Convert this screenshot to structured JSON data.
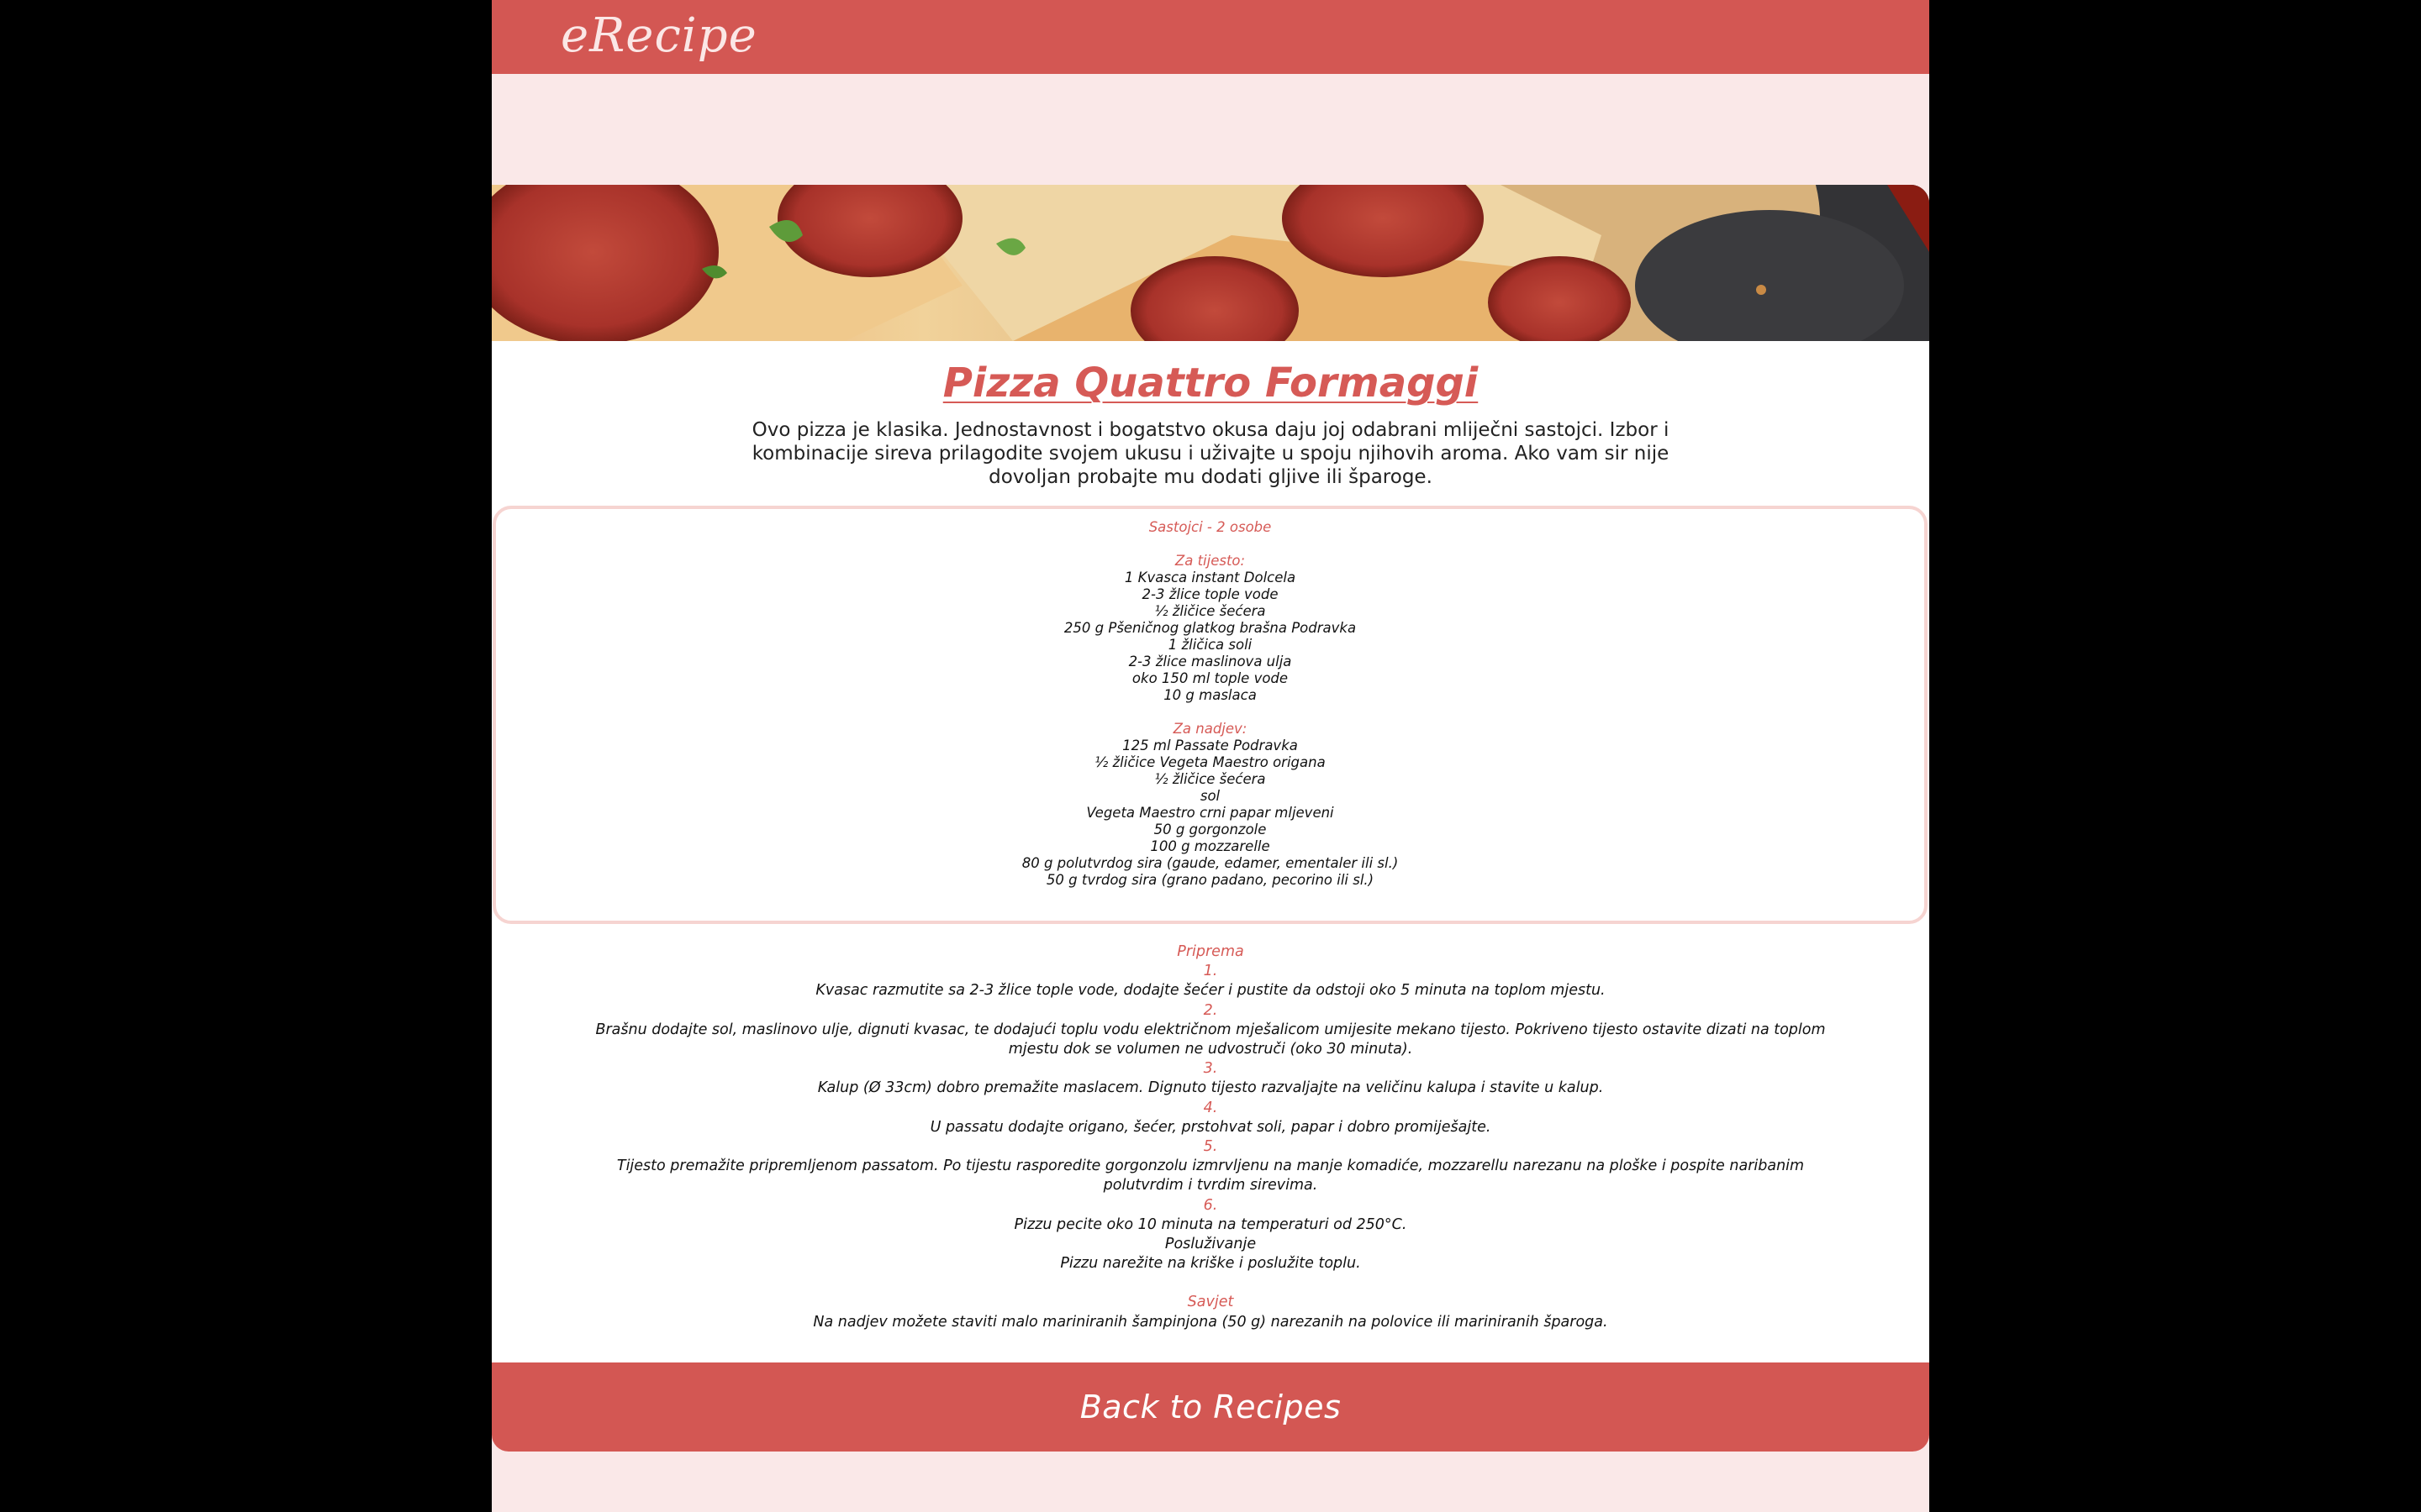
{
  "header": {
    "logo": "eRecipe"
  },
  "banner": {
    "alt": "pizza-photo"
  },
  "recipe": {
    "title": "Pizza Quattro Formaggi",
    "intro": "Ovo pizza je klasika. Jednostavnost i bogatstvo okusa daju joj odabrani mliječni sastojci. Izbor i kombinacije sireva prilagodite svojem ukusu i uživajte u spoju njihovih aroma. Ako vam sir nije dovoljan probajte mu dodati gljive ili šparoge.",
    "ingredients_heading": "Sastojci - 2 osobe",
    "dough_label": "Za tijesto:",
    "dough": [
      "1 Kvasca instant Dolcela",
      "2-3 žlice tople vode",
      "½ žličice šećera",
      "250 g Pšeničnog glatkog brašna Podravka",
      "1 žličica soli",
      "2-3 žlice maslinova ulja",
      "oko 150 ml tople vode",
      "10 g maslaca"
    ],
    "filling_label": "Za nadjev:",
    "filling": [
      "125 ml Passate Podravka",
      "½ žličice Vegeta Maestro origana",
      "½ žličice šećera",
      "sol",
      "Vegeta Maestro crni papar mljeveni",
      "50 g gorgonzole",
      "100 g mozzarelle",
      "80 g polutvrdog sira (gaude, edamer, ementaler ili sl.)",
      "50 g tvrdog sira (grano padano, pecorino ili sl.)"
    ],
    "prep_heading": "Priprema",
    "steps": [
      {
        "num": "1.",
        "text": "Kvasac razmutite sa 2-3 žlice tople vode, dodajte šećer i pustite da odstoji oko 5 minuta na toplom mjestu."
      },
      {
        "num": "2.",
        "text": "Brašnu dodajte sol, maslinovo ulje, dignuti kvasac, te dodajući toplu vodu električnom mješalicom umijesite mekano tijesto. Pokriveno tijesto ostavite dizati na toplom mjestu dok se volumen ne udvostruči (oko 30 minuta)."
      },
      {
        "num": "3.",
        "text": "Kalup (Ø 33cm) dobro premažite maslacem. Dignuto tijesto razvaljajte na veličinu kalupa i stavite u kalup."
      },
      {
        "num": "4.",
        "text": "U passatu dodajte origano, šećer, prstohvat soli, papar i dobro promiješajte."
      },
      {
        "num": "5.",
        "text": "Tijesto premažite pripremljenom passatom. Po tijestu rasporedite gorgonzolu izmrvljenu na manje komadiće, mozzarellu narezanu na ploške i pospite naribanim polutvrdim i tvrdim sirevima."
      },
      {
        "num": "6.",
        "text": "Pizzu pecite oko 10 minuta na temperaturi od 250°C."
      }
    ],
    "serving_heading": "Posluživanje",
    "serving_text": "Pizzu narežite na kriške i poslužite toplu.",
    "tip_heading": "Savjet",
    "tip_text": "Na nadjev možete staviti malo mariniranih šampinjona (50 g) narezanih na polovice ili mariniranih šparoga."
  },
  "footer": {
    "back_label": "Back to Recipes"
  },
  "colors": {
    "brand": "#d35753",
    "page_bg": "#fae8e8",
    "accent_text": "#d65a56",
    "box_border": "#f6d4d1"
  }
}
